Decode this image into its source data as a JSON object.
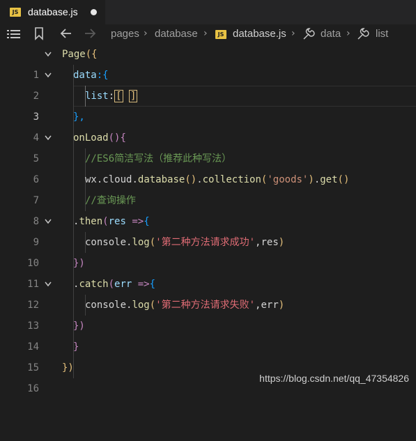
{
  "tab": {
    "badge": "JS",
    "filename": "database.js"
  },
  "breadcrumb": {
    "items": [
      "pages",
      "database",
      "database.js",
      "data",
      "list"
    ],
    "badge": "JS"
  },
  "editor": {
    "current_line": 3,
    "lines": [
      {
        "n": "1"
      },
      {
        "n": "2"
      },
      {
        "n": "3"
      },
      {
        "n": "4"
      },
      {
        "n": "5"
      },
      {
        "n": "6"
      },
      {
        "n": "7"
      },
      {
        "n": "8"
      },
      {
        "n": "9"
      },
      {
        "n": "10"
      },
      {
        "n": "11"
      },
      {
        "n": "12"
      },
      {
        "n": "13"
      },
      {
        "n": "14"
      },
      {
        "n": "15"
      },
      {
        "n": "16"
      }
    ],
    "code": {
      "l1a": "Page",
      "l1b": "({",
      "l2a": "data",
      "l2b": ":{",
      "l3a": "list",
      "l3b": ":",
      "l3c": "[",
      "l3d": " ",
      "l3e": "]",
      "l4": "},",
      "l5a": "onLoad",
      "l5b": "()",
      "l5c": "{",
      "l6": "//ES6简洁写法（推荐此种写法）",
      "l7a": "wx",
      "l7b": ".",
      "l7c": "cloud",
      "l7d": ".",
      "l7e": "database",
      "l7f": "()",
      "l7g": ".",
      "l7h": "collection",
      "l7i": "(",
      "l7j": "'goods'",
      "l7k": ")",
      "l7l": ".",
      "l7m": "get",
      "l7n": "()",
      "l8": "//查询操作",
      "l9a": ".",
      "l9b": "then",
      "l9c": "(",
      "l9d": "res",
      "l9e": " =>",
      "l9f": "{",
      "l10a": "console",
      "l10b": ".",
      "l10c": "log",
      "l10d": "(",
      "l10e": "'第二种方法请求成功'",
      "l10f": ",",
      "l10g": "res",
      "l10h": ")",
      "l11": "})",
      "l12a": ".",
      "l12b": "catch",
      "l12c": "(",
      "l12d": "err",
      "l12e": " =>",
      "l12f": "{",
      "l13a": "console",
      "l13b": ".",
      "l13c": "log",
      "l13d": "(",
      "l13e": "'第二种方法请求失败'",
      "l13f": ",",
      "l13g": "err",
      "l13h": ")",
      "l14": "})",
      "l15": "}",
      "l16": "})"
    }
  },
  "watermark": "https://blog.csdn.net/qq_47354826"
}
